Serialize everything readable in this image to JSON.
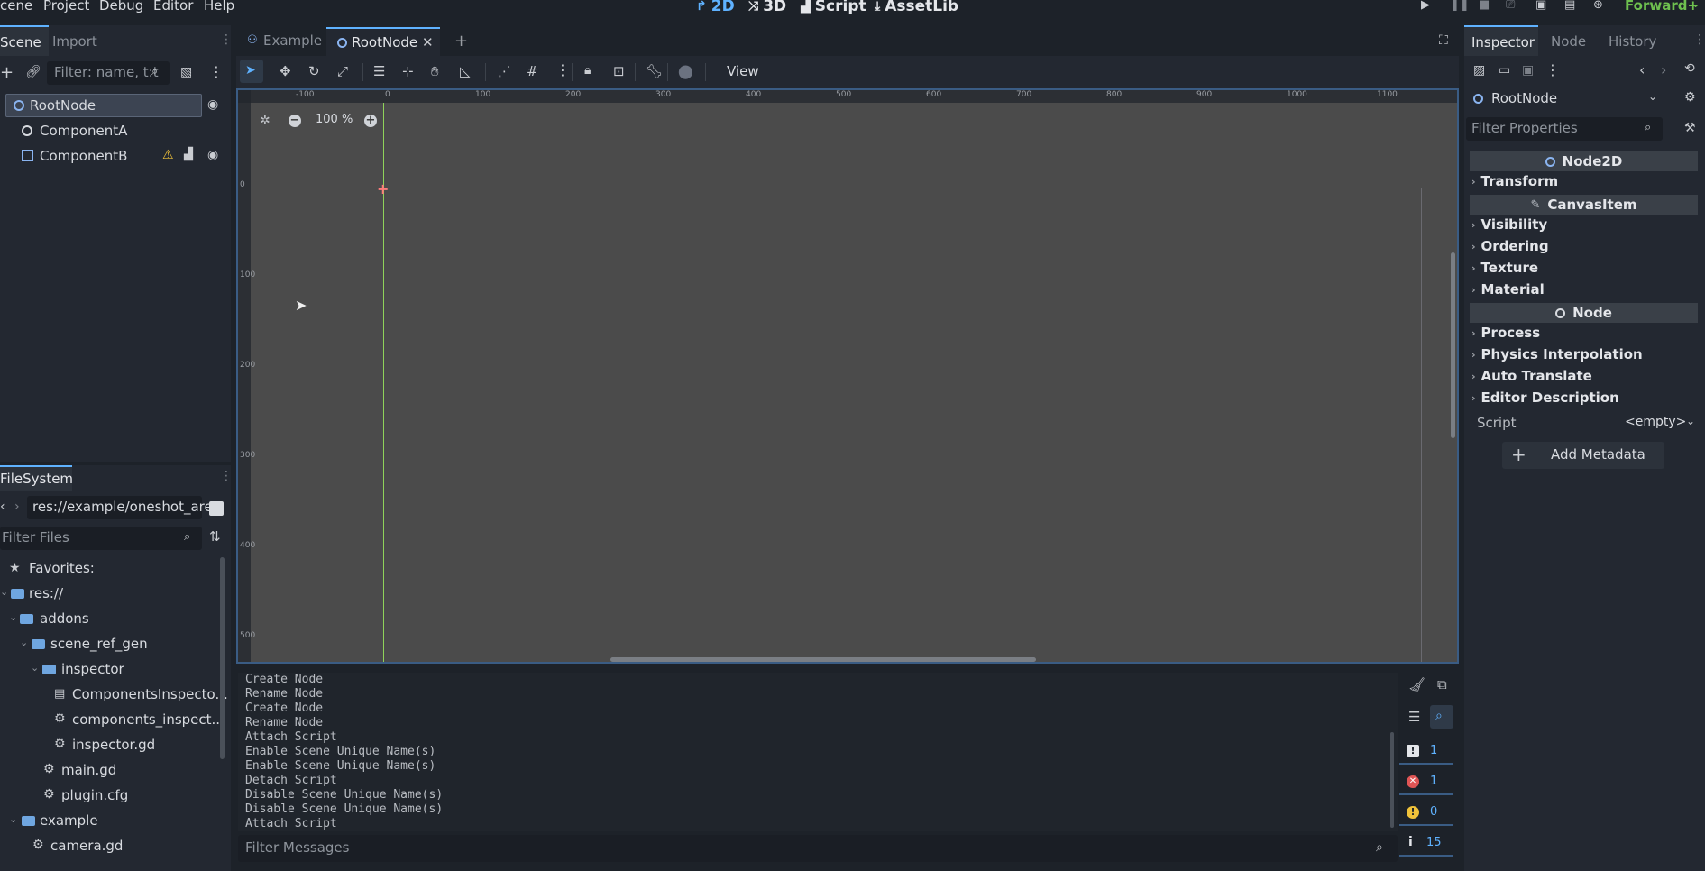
{
  "menu": {
    "scene": "cene",
    "project": "Project",
    "debug": "Debug",
    "editor": "Editor",
    "help": "Help"
  },
  "workspaces": {
    "w2d": "2D",
    "w3d": "3D",
    "script": "Script",
    "assetlib": "AssetLib"
  },
  "renderer": "Forward+",
  "scene_dock": {
    "tab_scene": "Scene",
    "tab_import": "Import",
    "filter_placeholder": "Filter: name, t:t",
    "nodes": [
      {
        "label": "RootNode"
      },
      {
        "label": "ComponentA"
      },
      {
        "label": "ComponentB"
      }
    ]
  },
  "filesystem": {
    "tab": "FileSystem",
    "path": "res://example/oneshot_are",
    "filter_placeholder": "Filter Files",
    "items": [
      {
        "label": "Favorites:"
      },
      {
        "label": "res://"
      },
      {
        "label": "addons"
      },
      {
        "label": "scene_ref_gen"
      },
      {
        "label": "inspector"
      },
      {
        "label": "ComponentsInspecto..."
      },
      {
        "label": "components_inspect..."
      },
      {
        "label": "inspector.gd"
      },
      {
        "label": "main.gd"
      },
      {
        "label": "plugin.cfg"
      },
      {
        "label": "example"
      },
      {
        "label": "camera.gd"
      }
    ]
  },
  "editor_tabs": [
    {
      "label": "Example"
    },
    {
      "label": "RootNode"
    }
  ],
  "toolbar": {
    "view_label": "View"
  },
  "viewport": {
    "zoom": "100 %",
    "ruler_top": [
      "-100",
      "0",
      "100",
      "200",
      "300",
      "400",
      "500",
      "600",
      "700",
      "800",
      "900",
      "1000",
      "1100"
    ],
    "ruler_left": [
      "0",
      "100",
      "200",
      "300",
      "400",
      "500"
    ]
  },
  "output": {
    "lines": [
      "Create Node",
      "Rename Node",
      "Create Node",
      "Rename Node",
      "Attach Script",
      "Enable Scene Unique Name(s)",
      "Enable Scene Unique Name(s)",
      "Detach Script",
      "Disable Scene Unique Name(s)",
      "Disable Scene Unique Name(s)",
      "Attach Script"
    ],
    "filter_placeholder": "Filter Messages",
    "counts": {
      "messages": "1",
      "errors": "1",
      "warnings": "0",
      "info": "15"
    }
  },
  "inspector": {
    "tab_inspector": "Inspector",
    "tab_node": "Node",
    "tab_history": "History",
    "selected_node": "RootNode",
    "filter_placeholder": "Filter Properties",
    "sections": {
      "node2d": "Node2D",
      "canvasitem": "CanvasItem",
      "node": "Node"
    },
    "groups": {
      "transform": "Transform",
      "visibility": "Visibility",
      "ordering": "Ordering",
      "texture": "Texture",
      "material": "Material",
      "process": "Process",
      "physics_interpolation": "Physics Interpolation",
      "auto_translate": "Auto Translate",
      "editor_description": "Editor Description"
    },
    "script_label": "Script",
    "script_value": "<empty>",
    "add_metadata": "Add Metadata"
  },
  "colors": {
    "accent": "#5fb2ff",
    "viewport_bg": "#4b4b4b",
    "axis_x": "#e0505a",
    "axis_y": "#8fd35a",
    "warning": "#f0c23a",
    "error": "#e05555",
    "renderer": "#6ec04f"
  }
}
